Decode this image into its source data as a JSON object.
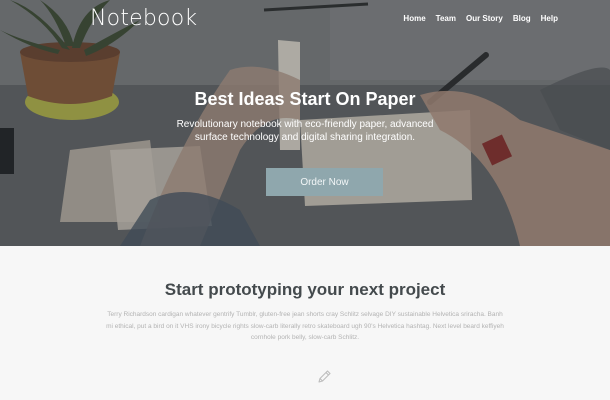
{
  "brand": "Notebook",
  "nav": [
    {
      "label": "Home"
    },
    {
      "label": "Team"
    },
    {
      "label": "Our Story"
    },
    {
      "label": "Blog"
    },
    {
      "label": "Help"
    }
  ],
  "hero": {
    "title": "Best Ideas Start On Paper",
    "subtitle": "Revolutionary notebook with eco-friendly paper, advanced surface technology and digital sharing integration.",
    "cta": "Order Now",
    "cta_color": "#8fa7ad"
  },
  "section": {
    "title": "Start prototyping your next project",
    "body": "Terry Richardson cardigan whatever gentrify Tumblr, gluten-free jean shorts cray Schlitz selvage DIY sustainable Helvetica sriracha. Banh mi ethical, put a bird on it VHS irony bicycle rights slow-carb literally retro skateboard ugh 90's Helvetica hashtag. Next level beard keffiyeh cornhole pork belly, slow-carb Schlitz.",
    "icon": "pencil-icon"
  }
}
